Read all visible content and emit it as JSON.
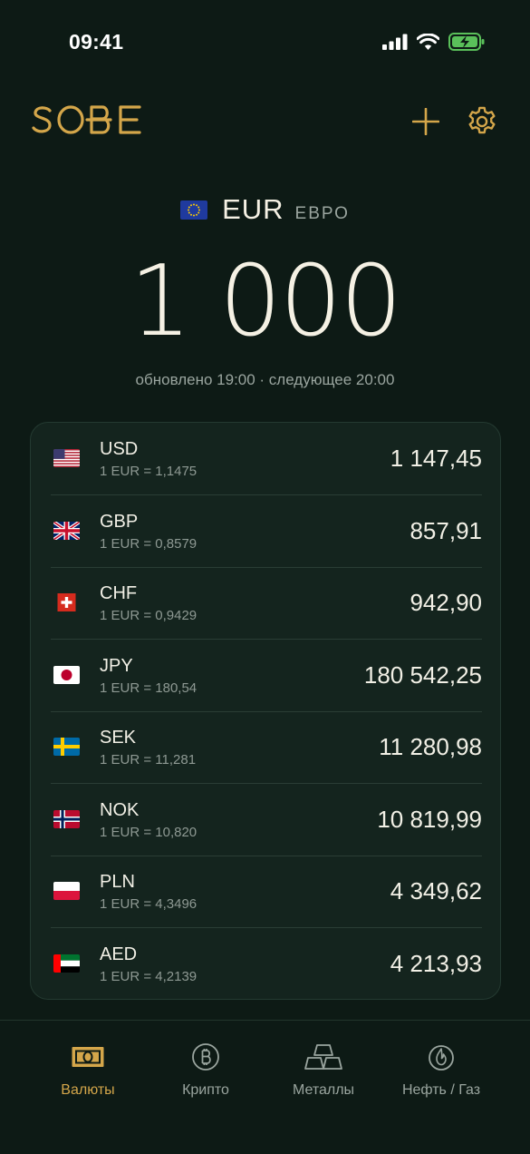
{
  "status": {
    "time": "09:41"
  },
  "header": {
    "logo": "SOBE",
    "add_icon": "plus-icon",
    "settings_icon": "gear-icon"
  },
  "base": {
    "flag": "eu-flag",
    "code": "EUR",
    "name": "ЕВРО",
    "amount": "1 000"
  },
  "update_info": "обновлено 19:00 · следующее 20:00",
  "rates": [
    {
      "code": "USD",
      "rate": "1 EUR = 1,1475",
      "value": "1 147,45",
      "flag": "us"
    },
    {
      "code": "GBP",
      "rate": "1 EUR = 0,8579",
      "value": "857,91",
      "flag": "gb"
    },
    {
      "code": "CHF",
      "rate": "1 EUR = 0,9429",
      "value": "942,90",
      "flag": "ch"
    },
    {
      "code": "JPY",
      "rate": "1 EUR = 180,54",
      "value": "180 542,25",
      "flag": "jp"
    },
    {
      "code": "SEK",
      "rate": "1 EUR = 11,281",
      "value": "11 280,98",
      "flag": "se"
    },
    {
      "code": "NOK",
      "rate": "1 EUR = 10,820",
      "value": "10 819,99",
      "flag": "no"
    },
    {
      "code": "PLN",
      "rate": "1 EUR = 4,3496",
      "value": "4 349,62",
      "flag": "pl"
    },
    {
      "code": "AED",
      "rate": "1 EUR = 4,2139",
      "value": "4 213,93",
      "flag": "ae"
    }
  ],
  "nav": [
    {
      "label": "Валюты",
      "icon": "banknote-icon",
      "active": true
    },
    {
      "label": "Крипто",
      "icon": "bitcoin-icon",
      "active": false
    },
    {
      "label": "Металлы",
      "icon": "gold-bars-icon",
      "active": false
    },
    {
      "label": "Нефть / Газ",
      "icon": "flame-icon",
      "active": false
    }
  ],
  "colors": {
    "background": "#0d1a15",
    "card": "#14241e",
    "accent": "#d4a64a",
    "text": "#f2f0e6",
    "muted": "#9aa59f"
  }
}
